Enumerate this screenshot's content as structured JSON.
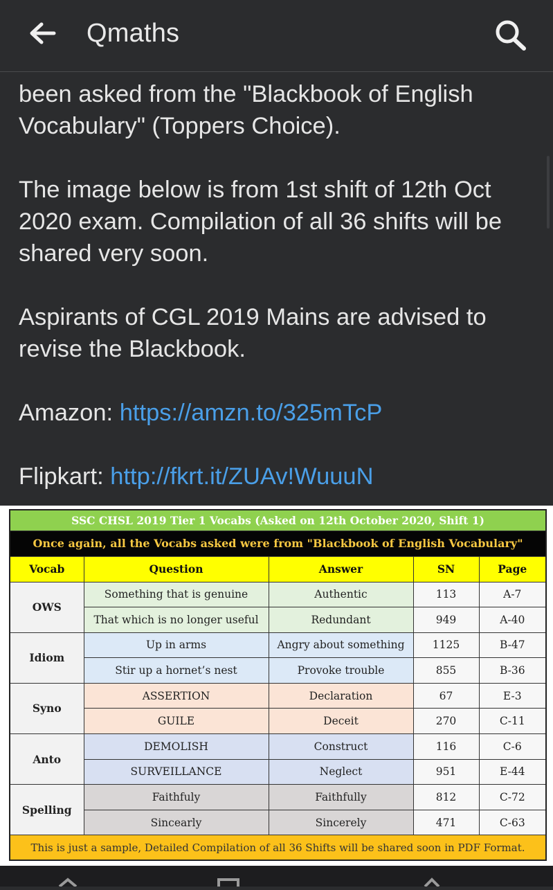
{
  "header": {
    "title": "Qmaths",
    "back_icon": "arrow-left-icon",
    "search_icon": "search-icon"
  },
  "post": {
    "para1": "been asked from the \"Blackbook of English Vocabulary\" (Toppers Choice).",
    "para2": "The image below is from 1st shift of 12th Oct 2020 exam. Compilation of all 36 shifts will be shared very soon.",
    "para3": "Aspirants of CGL 2019 Mains are advised to revise the Blackbook.",
    "amazon_label": "Amazon: ",
    "amazon_link": "https://amzn.to/325mTcP",
    "flipkart_label": "Flipkart: ",
    "flipkart_link": "http://fkrt.it/ZUAv!WuuuN"
  },
  "image_table": {
    "title": "SSC CHSL 2019 Tier 1 Vocabs (Asked on 12th October 2020, Shift 1)",
    "subtitle": "Once again, all the Vocabs asked were from \"Blackbook of English Vocabulary\"",
    "columns": [
      "Vocab",
      "Question",
      "Answer",
      "SN",
      "Page"
    ],
    "groups": [
      {
        "category": "OWS",
        "rows": [
          {
            "question": "Something that is genuine",
            "answer": "Authentic",
            "sn": "113",
            "page": "A-7"
          },
          {
            "question": "That which is no longer useful",
            "answer": "Redundant",
            "sn": "949",
            "page": "A-40"
          }
        ]
      },
      {
        "category": "Idiom",
        "rows": [
          {
            "question": "Up in arms",
            "answer": "Angry about something",
            "sn": "1125",
            "page": "B-47"
          },
          {
            "question": "Stir up a hornet’s nest",
            "answer": "Provoke trouble",
            "sn": "855",
            "page": "B-36"
          }
        ]
      },
      {
        "category": "Syno",
        "rows": [
          {
            "question": "ASSERTION",
            "answer": "Declaration",
            "sn": "67",
            "page": "E-3"
          },
          {
            "question": "GUILE",
            "answer": "Deceit",
            "sn": "270",
            "page": "C-11"
          }
        ]
      },
      {
        "category": "Anto",
        "rows": [
          {
            "question": "DEMOLISH",
            "answer": "Construct",
            "sn": "116",
            "page": "C-6"
          },
          {
            "question": "SURVEILLANCE",
            "answer": "Neglect",
            "sn": "951",
            "page": "E-44"
          }
        ]
      },
      {
        "category": "Spelling",
        "rows": [
          {
            "question": "Faithfuly",
            "answer": "Faithfully",
            "sn": "812",
            "page": "C-72"
          },
          {
            "question": "Sincearly",
            "answer": "Sincerely",
            "sn": "471",
            "page": "C-63"
          }
        ]
      }
    ],
    "footer": "This is just a sample, Detailed Compilation of all 36 Shifts will be shared soon in PDF Format."
  },
  "colors": {
    "background": "#2b2c2e",
    "link": "#4a9fe8",
    "title_bar": "#8fd14f",
    "header_row": "#ffff00",
    "footer_row": "#fcc11a"
  }
}
